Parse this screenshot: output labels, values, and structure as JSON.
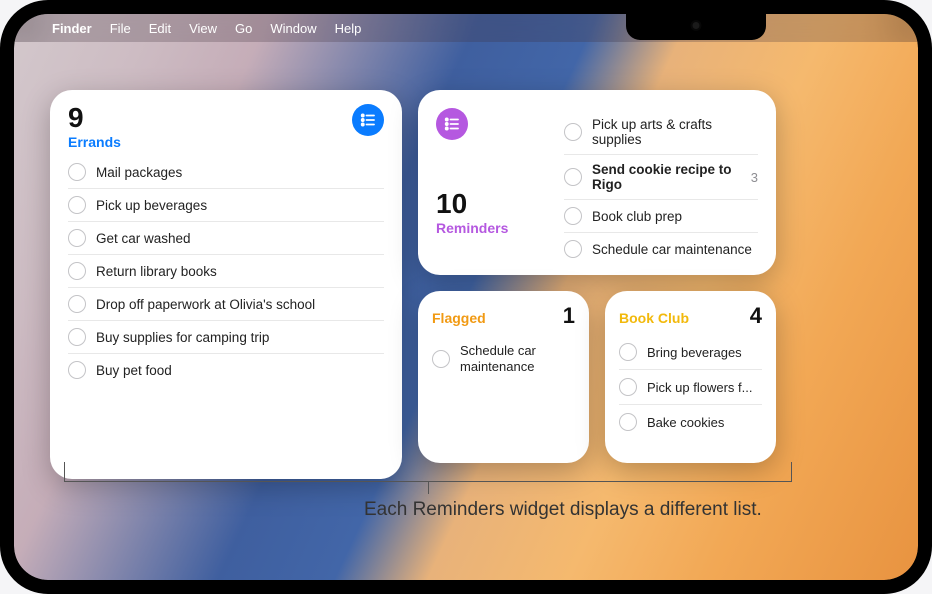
{
  "menubar": {
    "app": "Finder",
    "items": [
      "File",
      "Edit",
      "View",
      "Go",
      "Window",
      "Help"
    ]
  },
  "widgets": {
    "errands": {
      "count": "9",
      "name": "Errands",
      "items": [
        "Mail packages",
        "Pick up beverages",
        "Get car washed",
        "Return library books",
        "Drop off paperwork at Olivia's school",
        "Buy supplies for camping trip",
        "Buy pet food"
      ]
    },
    "reminders": {
      "count": "10",
      "name": "Reminders",
      "items": [
        {
          "text": "Pick up arts & crafts supplies",
          "bold": false,
          "badge": ""
        },
        {
          "text": "Send cookie recipe to Rigo",
          "bold": true,
          "badge": "3"
        },
        {
          "text": "Book club prep",
          "bold": false,
          "badge": ""
        },
        {
          "text": "Schedule car maintenance",
          "bold": false,
          "badge": ""
        }
      ]
    },
    "flagged": {
      "name": "Flagged",
      "count": "1",
      "items": [
        "Schedule car maintenance"
      ]
    },
    "bookclub": {
      "name": "Book Club",
      "count": "4",
      "items": [
        "Bring beverages",
        "Pick up flowers f...",
        "Bake cookies"
      ]
    }
  },
  "caption": "Each Reminders widget displays a different list."
}
